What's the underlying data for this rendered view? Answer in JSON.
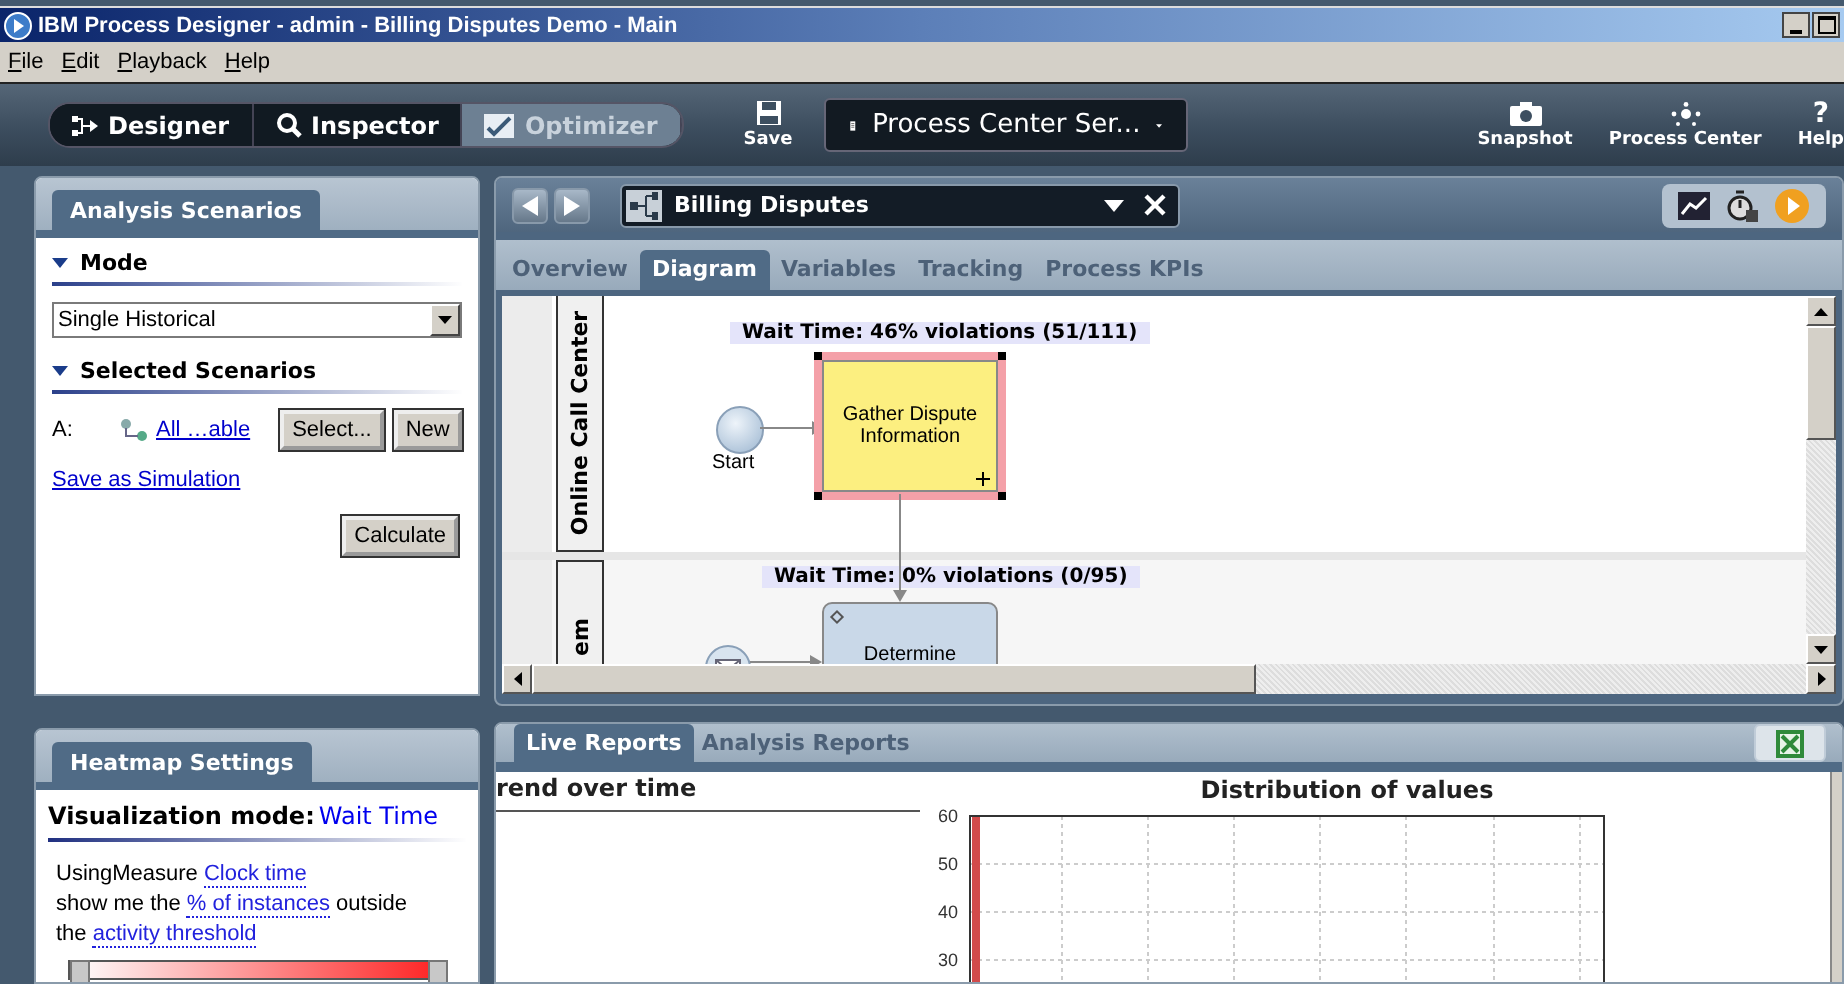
{
  "window": {
    "title": "IBM Process Designer -  admin - Billing Disputes Demo - Main"
  },
  "menu": [
    {
      "label": "File"
    },
    {
      "label": "Edit"
    },
    {
      "label": "Playback"
    },
    {
      "label": "Help"
    }
  ],
  "toolbar": {
    "modes": [
      {
        "label": "Designer",
        "kind": "designer",
        "selected": false
      },
      {
        "label": "Inspector",
        "kind": "inspector",
        "selected": false
      },
      {
        "label": "Optimizer",
        "kind": "optimizer",
        "selected": true
      }
    ],
    "save": "Save",
    "server": "Process Center Ser...",
    "actions": [
      {
        "label": "Snapshot",
        "kind": "snapshot"
      },
      {
        "label": "Process Center",
        "kind": "center"
      },
      {
        "label": "Help",
        "kind": "help",
        "glyph": "?"
      }
    ]
  },
  "analysis_panel": {
    "tab": "Analysis Scenarios",
    "mode_heading": "Mode",
    "mode_value": "Single Historical",
    "scenarios_heading": "Selected Scenarios",
    "row_label": "A:",
    "scenario_link": "All …able",
    "buttons": [
      "Select...",
      "New"
    ],
    "save_link": "Save as Simulation",
    "calculate": "Calculate"
  },
  "heatmap_panel": {
    "tab": "Heatmap Settings",
    "mode_label": "Visualization mode:",
    "mode_value": "Wait Time",
    "lines": [
      {
        "before": "UsingMeasure",
        "link": "Clock time"
      },
      {
        "before": "show me the",
        "link": "% of instances",
        "after": "outside"
      },
      {
        "before": "the",
        "link": "activity threshold"
      }
    ],
    "threshold": {
      "level": 1
    }
  },
  "editor": {
    "process": "Billing Disputes",
    "tabs": [
      {
        "label": "Overview",
        "selected": false
      },
      {
        "label": "Diagram",
        "selected": true
      },
      {
        "label": "Variables",
        "selected": false
      },
      {
        "label": "Tracking",
        "selected": false
      },
      {
        "label": "Process KPIs",
        "selected": false
      }
    ],
    "lanes": [
      {
        "name": "Online Call Center",
        "nodes": [
          {
            "kind": "start",
            "label": "Start"
          },
          {
            "kind": "task",
            "label": "Gather Dispute Information",
            "violation": "Wait Time: 46% violations (51/111)",
            "color": "#fcef80",
            "selected": true
          }
        ]
      },
      {
        "name": "em",
        "nodes": [
          {
            "kind": "message"
          },
          {
            "kind": "task",
            "label": "Determine",
            "violation": "Wait Time: 0% violations (0/95)",
            "color": "#c9d8e8",
            "selected": false
          }
        ]
      }
    ]
  },
  "reports": {
    "tabs": [
      {
        "label": "Live Reports",
        "selected": true
      },
      {
        "label": "Analysis Reports",
        "selected": false
      }
    ],
    "trend_title": "rend over time",
    "chart_data": {
      "type": "bar",
      "title": "Distribution of values",
      "values": [
        60
      ],
      "ylim": [
        25,
        60
      ],
      "yticks": [
        30,
        40,
        50,
        60
      ],
      "grid": true
    }
  }
}
